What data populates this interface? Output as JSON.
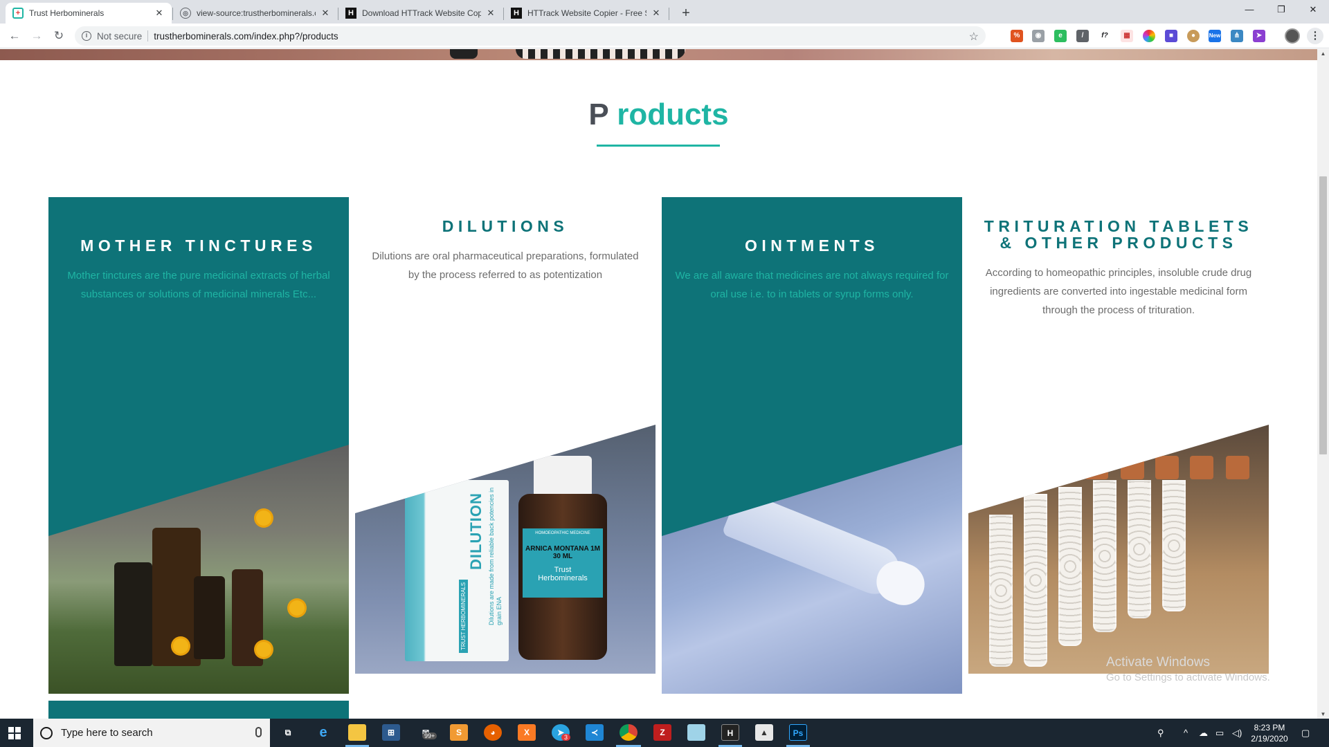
{
  "browser": {
    "tabs": [
      {
        "title": "Trust Herbominerals",
        "favicon": "trust-herbominerals-favicon",
        "active": true
      },
      {
        "title": "view-source:trustherbominerals.c",
        "favicon": "globe-icon",
        "active": false
      },
      {
        "title": "Download HTTrack Website Copi",
        "favicon": "httrack-icon",
        "active": false
      },
      {
        "title": "HTTrack Website Copier - Free Sc",
        "favicon": "httrack-icon",
        "active": false
      }
    ],
    "security_label": "Not secure",
    "url": "trustherbominerals.com/index.php?/products"
  },
  "page": {
    "section_title_first": "P",
    "section_title_rest": " roducts",
    "accent_color": "#1fb5a4",
    "card_teal_color": "#0e7378",
    "cards": [
      {
        "title": "MOTHER TINCTURES",
        "description": "Mother tinctures are the pure medicinal extracts of herbal substances or solutions of medicinal minerals Etc...",
        "image": "herbal-bottles-flowers-photo"
      },
      {
        "title": "DILUTIONS",
        "description": "Dilutions are oral pharmaceutical preparations, formulated by the process referred to as potentization",
        "image": "dilution-bottle-box-photo",
        "image_text": {
          "box_label": "DILUTION",
          "box_sub": "Dilutions are made from reliable back potencies in grain ENA",
          "box_brand": "TRUST HERBOMINERALS",
          "bottle_header": "HOMOEOPATHIC MEDICINE",
          "bottle_name": "ARNICA MONTANA 1M",
          "bottle_volume": "30 ML",
          "bottle_brand_1": "Trust",
          "bottle_brand_2": "Herbominerals"
        }
      },
      {
        "title": "OINTMENTS",
        "description": "We are all aware that medicines are not always required for oral use i.e. to in tablets or syrup forms only.",
        "image": "ointment-tube-photo"
      },
      {
        "title_line1": "TRITURATION TABLETS",
        "title_line2": "& OTHER PRODUCTS",
        "description": "According to homeopathic principles, insoluble crude drug ingredients are converted into ingestable medicinal form through the process of trituration.",
        "image": "globule-vials-photo"
      }
    ],
    "watermark": {
      "line1": "Activate Windows",
      "line2": "Go to Settings to activate Windows."
    }
  },
  "taskbar": {
    "search_placeholder": "Type here to search",
    "time": "8:23 PM",
    "date": "2/19/2020",
    "badges": {
      "mail": "99+",
      "telegram": "3"
    }
  }
}
